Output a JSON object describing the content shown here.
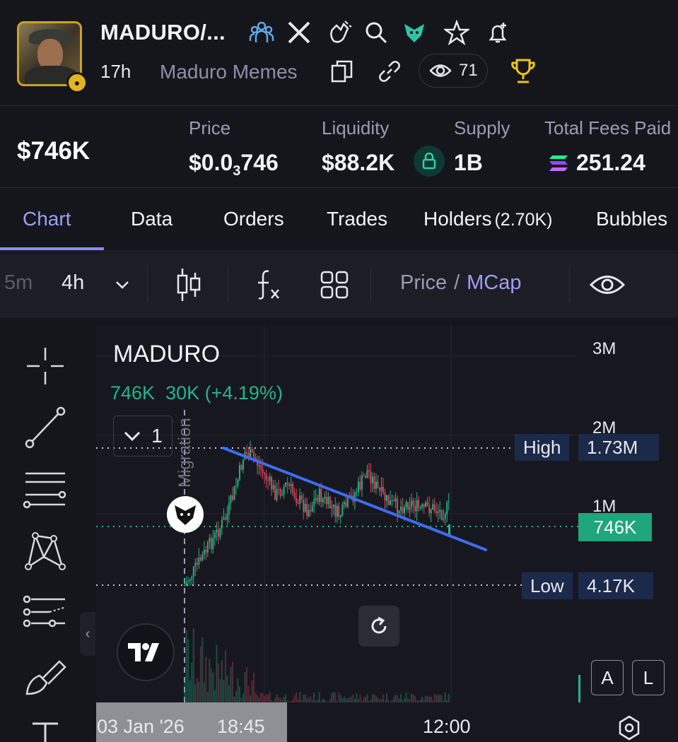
{
  "header": {
    "title": "MADURO/...",
    "age": "17h",
    "community": "Maduro Memes",
    "views": "71"
  },
  "stats": {
    "market_cap": "$746K",
    "price_label": "Price",
    "price_prefix": "$0.0",
    "price_sub": "3",
    "price_suffix": "746",
    "liquidity_label": "Liquidity",
    "liquidity_value": "$88.2K",
    "supply_label": "Supply",
    "supply_value": "1B",
    "fees_label": "Total Fees Paid",
    "fees_value": "251.24"
  },
  "tabs": [
    {
      "label": "Chart",
      "active": true
    },
    {
      "label": "Data"
    },
    {
      "label": "Orders"
    },
    {
      "label": "Trades"
    },
    {
      "label": "Holders",
      "count": "(2.70K)"
    },
    {
      "label": "Bubbles"
    }
  ],
  "toolbar": {
    "interval_prev": "5m",
    "interval": "4h",
    "price_label": "Price",
    "separator": "/",
    "mcap_label": "MCap"
  },
  "chart": {
    "symbol": "MADURO",
    "last_value": "746K",
    "change": "30K",
    "change_pct": "(+4.19%)",
    "collapse_count": "1",
    "migration_label": "Migration",
    "y_ticks": [
      "3M",
      "2M",
      "1M"
    ],
    "high_label": "High",
    "high_value": "1.73M",
    "low_label": "Low",
    "low_value": "4.17K",
    "current_value": "746K",
    "x_labels": [
      "03 Jan '26",
      "18:45",
      "12:00"
    ],
    "btn_auto": "A",
    "btn_log": "L"
  },
  "colors": {
    "accent": "#8c8ef0",
    "up": "#25b58b",
    "down": "#e0455b",
    "trendline": "#3d6df2"
  },
  "chart_data": {
    "type": "candlestick",
    "title": "MADURO",
    "y_unit": "market cap (USD)",
    "ylim": [
      0,
      3000000
    ],
    "y_ticks": [
      1000000,
      2000000,
      3000000
    ],
    "high": 1730000,
    "low": 4170,
    "last": 746000,
    "change": 30000,
    "change_pct": 4.19,
    "x_labels": [
      "03 Jan '26 18:45",
      "12:00"
    ],
    "trend_line": {
      "from": 1730000,
      "to": 560000
    }
  }
}
